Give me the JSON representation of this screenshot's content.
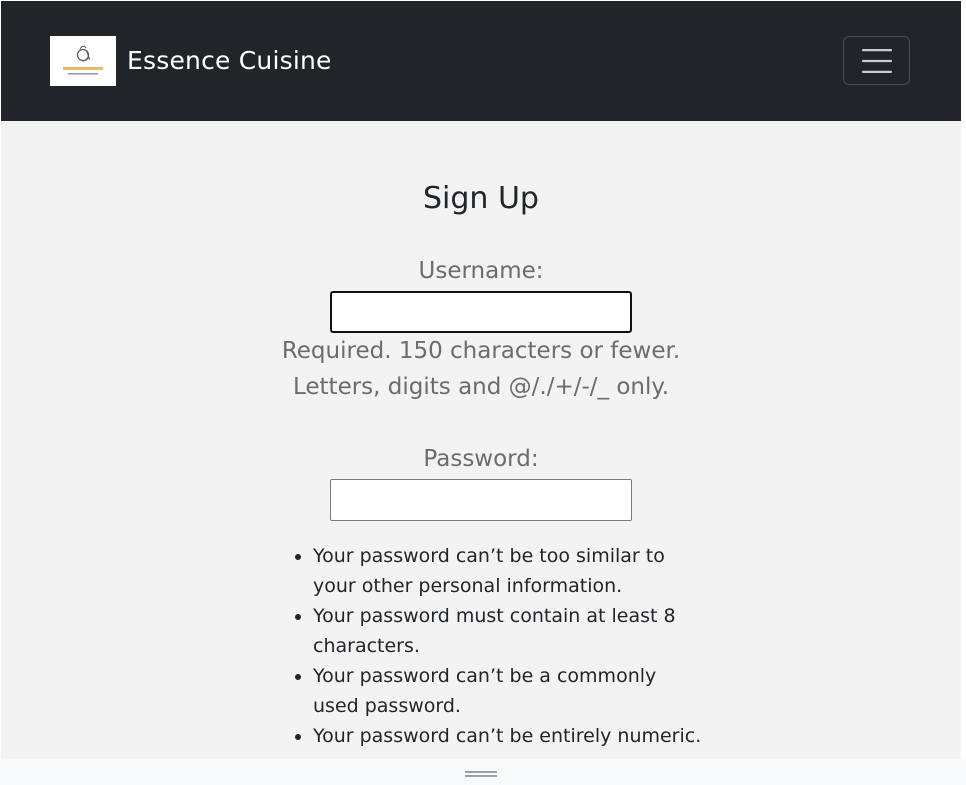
{
  "navbar": {
    "brand_name": "Essence Cuisine",
    "logo_icon": "essence-cuisine-logo",
    "toggler_icon": "hamburger-menu-icon",
    "bg_color": "#212529"
  },
  "form": {
    "title": "Sign Up",
    "username_label": "Username:",
    "username_value": "",
    "username_help_line1": "Required. 150 characters or fewer.",
    "username_help_line2": "Letters, digits and @/./+/-/_ only.",
    "password_label": "Password:",
    "password_value": "",
    "password_rules": [
      "Your password can’t be too similar to your other personal information.",
      "Your password must contain at least 8 characters.",
      "Your password can’t be a commonly used password.",
      "Your password can’t be entirely numeric."
    ]
  },
  "bottom_bar": {
    "grip_icon": "drag-handle-icon"
  }
}
